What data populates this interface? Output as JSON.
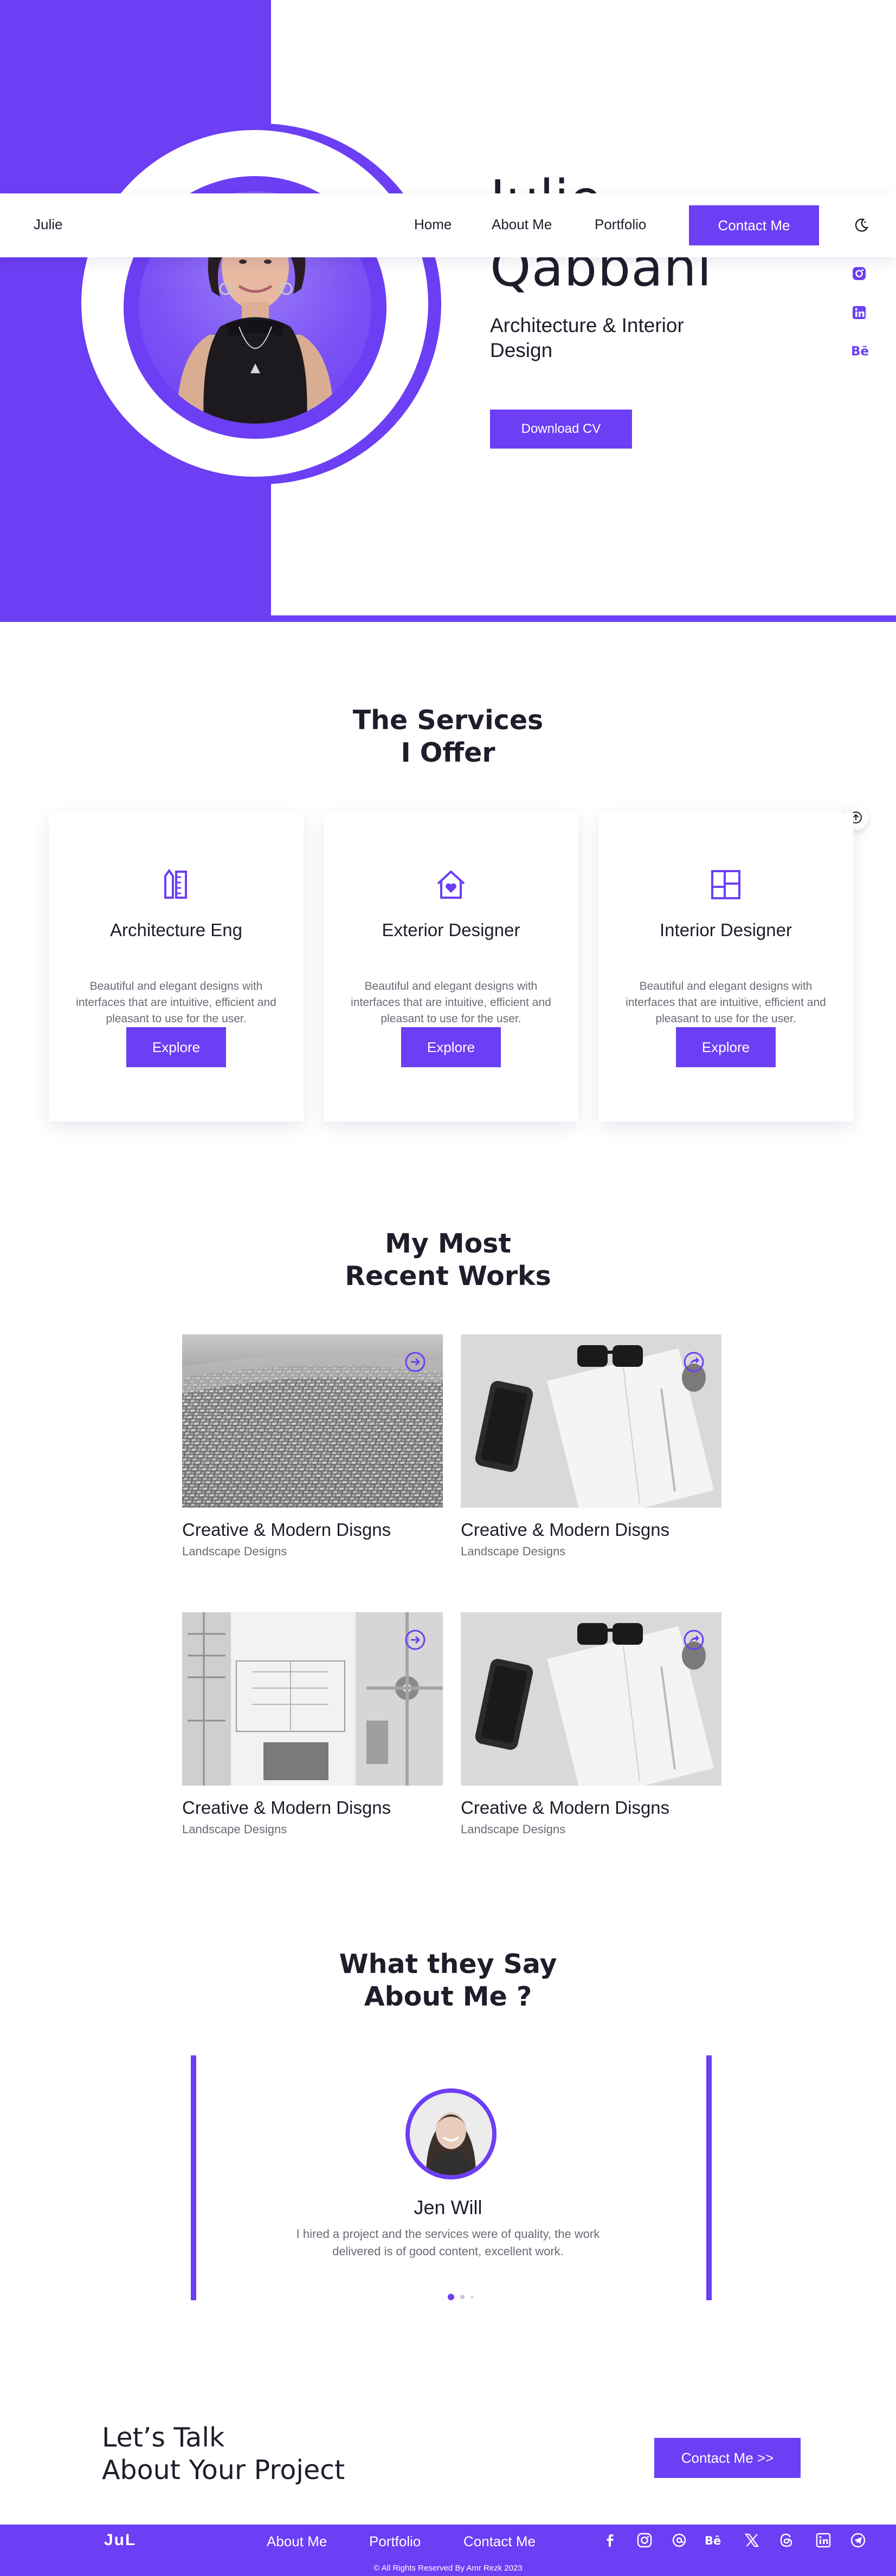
{
  "nav": {
    "logo": "Julie",
    "links": [
      "Home",
      "About Me",
      "Portfolio"
    ],
    "contact_label": "Contact Me",
    "theme_icon": "moon-icon"
  },
  "hero": {
    "first_name": "Julie",
    "last_name": "Qabbani",
    "subtitle": "Architecture & Interior Design",
    "download_label": "Download CV",
    "social_icons": [
      "instagram-icon",
      "linkedin-icon",
      "behance-icon"
    ],
    "accent": "#6c3ef4"
  },
  "services": {
    "title_line1": "The Services",
    "title_line2": "I Offer",
    "items": [
      {
        "icon": "ruler-pencil-icon",
        "title": "Architecture Eng",
        "desc": "Beautiful and elegant designs with interfaces that are intuitive, efficient and pleasant to use for the user.",
        "button": "Explore"
      },
      {
        "icon": "house-heart-icon",
        "title": "Exterior Designer",
        "desc": "Beautiful and elegant designs with interfaces that are intuitive, efficient and pleasant to use for the user.",
        "button": "Explore"
      },
      {
        "icon": "layout-icon",
        "title": "Interior Designer",
        "desc": "Beautiful and elegant designs with interfaces that are intuitive, efficient and pleasant to use for the user.",
        "button": "Explore"
      }
    ]
  },
  "works": {
    "title_line1": "My Most",
    "title_line2": "Recent Works",
    "items": [
      {
        "title": "Creative & Modern Disgns",
        "category": "Landscape Designs",
        "image": "aerial-city-model"
      },
      {
        "title": "Creative & Modern Disgns",
        "category": "Landscape Designs",
        "image": "desk-flatlay"
      },
      {
        "title": "Creative & Modern Disgns",
        "category": "Landscape Designs",
        "image": "blueprint-plans"
      },
      {
        "title": "Creative & Modern Disgns",
        "category": "Landscape Designs",
        "image": "desk-flatlay"
      }
    ]
  },
  "testimonials": {
    "title_line1": "What they Say",
    "title_line2": "About Me ?",
    "name": "Jen Will",
    "quote": "I hired a project and the services were of quality, the work delivered is of good content, excellent work.",
    "active_slide": 1,
    "slide_count": 3
  },
  "cta": {
    "line1": "Let’s Talk",
    "line2": "About Your Project",
    "button": "Contact Me >>"
  },
  "footer": {
    "logo": "JuL",
    "links": [
      "About Me",
      "Portfolio",
      "Contact Me"
    ],
    "social_icons": [
      "facebook-icon",
      "instagram-icon",
      "threads-icon",
      "behance-icon",
      "x-icon",
      "threads-alt-icon",
      "linkedin-icon",
      "telegram-icon"
    ],
    "copyright": "© All Rights Reserved By Amr Rezk 2023"
  }
}
